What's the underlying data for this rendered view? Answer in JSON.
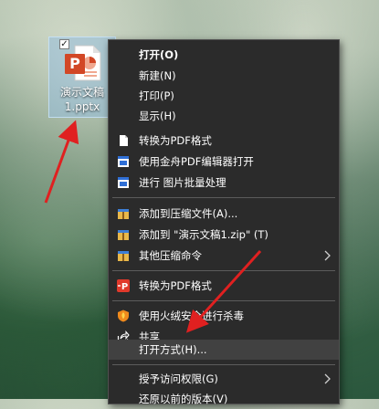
{
  "desktop_icon": {
    "label": "演示文稿\n1.pptx",
    "checkbox_mark": "✓"
  },
  "context_menu": {
    "items": [
      {
        "name": "open",
        "label": "打开(O)",
        "bold": true
      },
      {
        "name": "new",
        "label": "新建(N)"
      },
      {
        "name": "print",
        "label": "打印(P)"
      },
      {
        "name": "show",
        "label": "显示(H)"
      },
      {
        "name": "convert-pdf-wps",
        "label": "转换为PDF格式",
        "icon": "document-icon"
      },
      {
        "name": "open-with-jinzhou",
        "label": "使用金舟PDF编辑器打开",
        "icon": "pdf-editor-icon"
      },
      {
        "name": "batch-image",
        "label": "进行 图片批量处理",
        "icon": "image-batch-icon"
      },
      {
        "name": "add-to-archive",
        "label": "添加到压缩文件(A)...",
        "icon": "archive-icon"
      },
      {
        "name": "add-to-zip",
        "label": "添加到 \"演示文稿1.zip\" (T)",
        "icon": "archive-icon"
      },
      {
        "name": "other-compress",
        "label": "其他压缩命令",
        "icon": "archive-icon",
        "submenu": true
      },
      {
        "name": "convert-pdf",
        "label": "转换为PDF格式",
        "icon": "convert-pdf-icon"
      },
      {
        "name": "scan-virus",
        "label": "使用火绒安全进行杀毒",
        "icon": "shield-icon"
      },
      {
        "name": "share",
        "label": "共享",
        "icon": "share-icon"
      },
      {
        "name": "open-with",
        "label": "打开方式(H)...",
        "highlighted": true
      },
      {
        "name": "grant-access",
        "label": "授予访问权限(G)",
        "submenu": true
      },
      {
        "name": "restore-version",
        "label": "还原以前的版本(V)"
      }
    ]
  },
  "colors": {
    "menu_background": "#2b2b2b",
    "menu_highlight": "#414141",
    "menu_text": "#ffffff",
    "annotation_arrow": "#e02020",
    "pptx_orange": "#d24726"
  }
}
